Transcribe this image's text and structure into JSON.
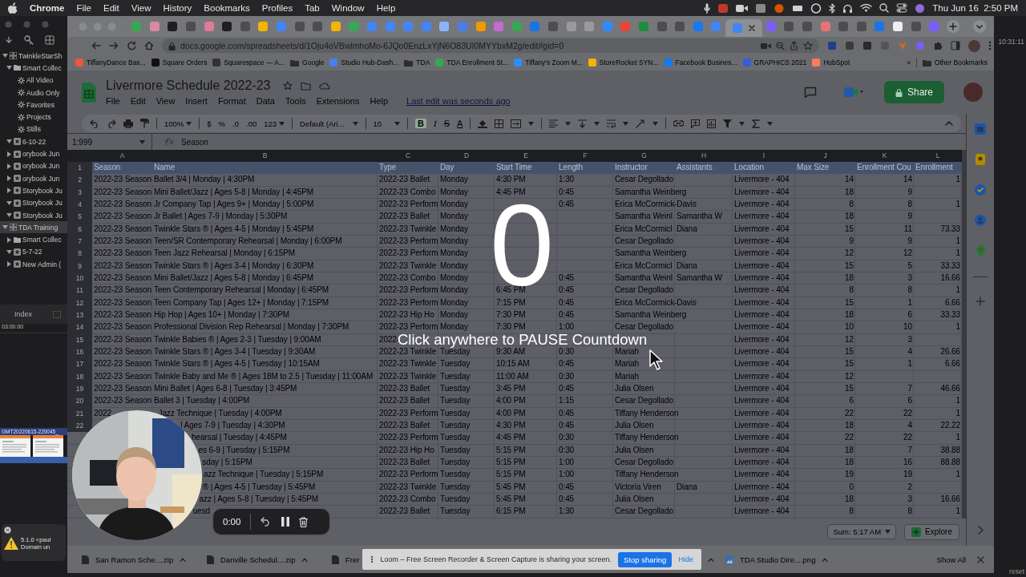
{
  "menubar": {
    "app": "Chrome",
    "menus": [
      "File",
      "Edit",
      "View",
      "History",
      "Bookmarks",
      "Profiles",
      "Tab",
      "Window",
      "Help"
    ],
    "clock": "Thu Jun 16  2:50 PM"
  },
  "library": {
    "items": [
      {
        "label": "TwinkleStarSh",
        "kind": "library",
        "expanded": true,
        "selected": false,
        "children": [
          {
            "label": "Smart Collec",
            "kind": "folder",
            "expanded": true,
            "selected": false,
            "children": [
              {
                "label": "All Video",
                "kind": "smart",
                "selected": false
              },
              {
                "label": "Audio Only",
                "kind": "smart",
                "selected": false
              },
              {
                "label": "Favorites",
                "kind": "smart",
                "selected": false
              },
              {
                "label": "Projects",
                "kind": "smart",
                "selected": false
              },
              {
                "label": "Stills",
                "kind": "smart",
                "selected": false
              }
            ]
          },
          {
            "label": "6-10-22",
            "kind": "event",
            "expanded": true,
            "selected": false
          },
          {
            "label": "orybook Jun",
            "kind": "event",
            "expanded": false,
            "selected": false
          },
          {
            "label": "orybook Jun",
            "kind": "event",
            "expanded": false,
            "selected": false
          },
          {
            "label": "orybook Jun",
            "kind": "event",
            "expanded": false,
            "selected": false
          },
          {
            "label": "Storybook Ju",
            "kind": "event",
            "expanded": false,
            "selected": false
          },
          {
            "label": "Storybook Ju",
            "kind": "event",
            "expanded": true,
            "selected": false
          },
          {
            "label": "Storybook Ju",
            "kind": "event",
            "expanded": true,
            "selected": false
          }
        ]
      },
      {
        "label": "TDA Training",
        "kind": "library",
        "expanded": true,
        "selected": true,
        "children": [
          {
            "label": "Smart Collec",
            "kind": "folder",
            "expanded": false,
            "selected": false
          },
          {
            "label": "5-7-22",
            "kind": "event",
            "expanded": true,
            "selected": false
          },
          {
            "label": "New Admin (",
            "kind": "event",
            "expanded": false,
            "selected": false
          }
        ]
      }
    ],
    "index_button": "Index",
    "timecode": "03:00:00",
    "clip_label": "GMT20220615-220045_",
    "alert_lines": [
      "5.1.0 <paul",
      "Domain un"
    ]
  },
  "browser": {
    "tabs": [
      {
        "selected": false,
        "color": "#34a853"
      },
      {
        "selected": false,
        "color": "#d98aa0"
      },
      {
        "selected": false,
        "color": "#1f1f1f"
      },
      {
        "selected": false,
        "color": "#4d4d4d"
      },
      {
        "selected": false,
        "color": "#e07a95"
      },
      {
        "selected": false,
        "color": "#1f1f1f"
      },
      {
        "selected": false,
        "color": "#4d4d4d"
      },
      {
        "selected": false,
        "color": "#f4b400"
      },
      {
        "selected": false,
        "color": "#4285f4"
      },
      {
        "selected": false,
        "color": "#4d4d4d"
      },
      {
        "selected": false,
        "color": "#4d4d4d"
      },
      {
        "selected": false,
        "color": "#f4b400"
      },
      {
        "selected": false,
        "color": "#34a853"
      },
      {
        "selected": false,
        "color": "#4285f4"
      },
      {
        "selected": false,
        "color": "#4285f4"
      },
      {
        "selected": false,
        "color": "#4285f4"
      },
      {
        "selected": false,
        "color": "#4285f4"
      },
      {
        "selected": false,
        "color": "#8ab4f8"
      },
      {
        "selected": false,
        "color": "#4a7ee8"
      },
      {
        "selected": false,
        "color": "#f29900"
      },
      {
        "selected": false,
        "color": "#c46bd0"
      },
      {
        "selected": false,
        "color": "#34a853"
      },
      {
        "selected": false,
        "color": "#1a73e8"
      },
      {
        "selected": false,
        "color": "#4d4d4d"
      },
      {
        "selected": false,
        "color": "#9a9a9a"
      },
      {
        "selected": false,
        "color": "#9a9a9a"
      },
      {
        "selected": false,
        "color": "#2d8cff"
      },
      {
        "selected": false,
        "color": "#ea4335"
      },
      {
        "selected": false,
        "color": "#1e8e3e"
      },
      {
        "selected": false,
        "color": "#4d4d4d"
      },
      {
        "selected": false,
        "color": "#4d4d4d"
      },
      {
        "selected": false,
        "color": "#1877f2"
      },
      {
        "selected": false,
        "color": "#4285f4"
      },
      {
        "selected": true,
        "color": "#4285f4"
      },
      {
        "selected": false,
        "color": "#7c5cff"
      },
      {
        "selected": false,
        "color": "#4d4d4d"
      },
      {
        "selected": false,
        "color": "#4d4d4d"
      },
      {
        "selected": false,
        "color": "#e57373"
      },
      {
        "selected": false,
        "color": "#4d4d4d"
      },
      {
        "selected": false,
        "color": "#4d4d4d"
      },
      {
        "selected": false,
        "color": "#1a73e8"
      },
      {
        "selected": false,
        "color": "#eeeeee"
      },
      {
        "selected": false,
        "color": "#4d4d4d"
      },
      {
        "selected": false,
        "color": "#7c5cff"
      }
    ],
    "url": "docs.google.com/spreadsheets/d/1Oju4oVBwlmhoMo-6JQo0EnzLxYjN6O83UI0MYYbxM2g/edit#gid=0",
    "bookmarks": [
      {
        "label": "TiffanyDance Bas...",
        "kind": "site",
        "color": "#e8593c"
      },
      {
        "label": "Square Orders",
        "kind": "site",
        "color": "#111111"
      },
      {
        "label": "Squarespace — A...",
        "kind": "site",
        "color": "#333333"
      },
      {
        "label": "Google",
        "kind": "folder"
      },
      {
        "label": "Studio Hub-Dash...",
        "kind": "site",
        "color": "#4a7ee8"
      },
      {
        "label": "TDA",
        "kind": "folder"
      },
      {
        "label": "TDA Enrollment St...",
        "kind": "site",
        "color": "#34a853"
      },
      {
        "label": "Tiffany's Zoom M...",
        "kind": "site",
        "color": "#2d8cff"
      },
      {
        "label": "StoreRocket SYN...",
        "kind": "site",
        "color": "#f4b400"
      },
      {
        "label": "Facebook Busines...",
        "kind": "site",
        "color": "#1877f2"
      },
      {
        "label": "GRAPHICS 2021",
        "kind": "site",
        "color": "#3b5bdb"
      },
      {
        "label": "HubSpot",
        "kind": "site",
        "color": "#ff7a59"
      }
    ],
    "more_bookmarks": "»",
    "other_bookmarks": "Other Bookmarks"
  },
  "sheet": {
    "title": "Livermore Schedule 2022-23",
    "menus": [
      "File",
      "Edit",
      "View",
      "Insert",
      "Format",
      "Data",
      "Tools",
      "Extensions",
      "Help"
    ],
    "last_edit": "Last edit was seconds ago",
    "share": "Share",
    "toolbar": {
      "zoom": "100%",
      "currency": "$",
      "percent": "%",
      "decimal_less": ".0",
      "decimal_more": ".00",
      "number_format": "123",
      "font": "Default (Ari...",
      "font_size": "10",
      "bold": "B",
      "italic": "I",
      "strikethrough": "S",
      "text_color": "A"
    },
    "name_box": "1:999",
    "formula": "Season",
    "columns": [
      {
        "letter": "A",
        "kind": "text"
      },
      {
        "letter": "B",
        "kind": "text"
      },
      {
        "letter": "C",
        "kind": "text"
      },
      {
        "letter": "D",
        "kind": "text"
      },
      {
        "letter": "E",
        "kind": "text"
      },
      {
        "letter": "F",
        "kind": "text"
      },
      {
        "letter": "G",
        "kind": "text"
      },
      {
        "letter": "H",
        "kind": "text"
      },
      {
        "letter": "I",
        "kind": "text"
      },
      {
        "letter": "J",
        "kind": "number"
      },
      {
        "letter": "K",
        "kind": "number"
      },
      {
        "letter": "L",
        "kind": "number"
      }
    ],
    "rows": [
      {
        "number": "1",
        "kind": "header",
        "cells": [
          "Season",
          "Name",
          "Type",
          "Day",
          "Start Time",
          "Length",
          "Instructor",
          "Assistants",
          "Location",
          "Max Size",
          "Enrollment Cou",
          "Enrollment"
        ]
      },
      {
        "number": "2",
        "kind": "data",
        "cells": [
          "2022-23 Season",
          "Ballet 3/4 | Monday | 4:30PM",
          "2022-23 Ballet",
          "Monday",
          "4:30 PM",
          "1:30",
          "Cesar Degollado",
          null,
          "Livermore - 404",
          "14",
          "14",
          "1"
        ]
      },
      {
        "number": "3",
        "kind": "data",
        "cells": [
          "2022-23 Season",
          "Mini Ballet/Jazz | Ages 5-8 | Monday | 4:45PM",
          "2022-23 Combo",
          "Monday",
          "4:45 PM",
          "0:45",
          "Samantha Weinberg",
          null,
          "Livermore - 404",
          "18",
          "9",
          null
        ]
      },
      {
        "number": "4",
        "kind": "data",
        "cells": [
          "2022-23 Season",
          "Jr Company Tap | Ages 9+ | Monday | 5:00PM",
          "2022-23 Perform",
          "Monday",
          null,
          "0:45",
          "Erica McCormick-Davis",
          null,
          "Livermore - 404",
          "8",
          "8",
          "1"
        ]
      },
      {
        "number": "5",
        "kind": "data",
        "cells": [
          "2022-23 Season",
          "Jr Ballet | Ages 7-9 | Monday | 5:30PM",
          "2022-23 Ballet",
          "Monday",
          null,
          null,
          "Samantha Weinl",
          "Samantha W",
          "Livermore - 404",
          "18",
          "9",
          null
        ]
      },
      {
        "number": "6",
        "kind": "data",
        "cells": [
          "2022-23 Season",
          "Twinkle Stars ® | Ages 4-5 | Monday | 5:45PM",
          "2022-23 Twinkle",
          "Monday",
          null,
          null,
          "Erica McCormicl",
          "Diana",
          "Livermore - 404",
          "15",
          "11",
          "73.33"
        ]
      },
      {
        "number": "7",
        "kind": "data",
        "cells": [
          "2022-23 Season",
          "Teen/SR Contemporary Rehearsal | Monday | 6:00PM",
          "2022-23 Perform",
          "Monday",
          null,
          null,
          "Cesar Degollado",
          null,
          "Livermore - 404",
          "9",
          "9",
          "1"
        ]
      },
      {
        "number": "8",
        "kind": "data",
        "cells": [
          "2022-23 Season",
          "Teen Jazz Rehearsal | Monday | 6:15PM",
          "2022-23 Perform",
          "Monday",
          null,
          null,
          "Samantha Weinberg",
          null,
          "Livermore - 404",
          "12",
          "12",
          "1"
        ]
      },
      {
        "number": "9",
        "kind": "data",
        "cells": [
          "2022-23 Season",
          "Twinkle Stars ® | Ages 3-4 | Monday | 6:30PM",
          "2022-23 Twinkle",
          "Monday",
          null,
          null,
          "Erica McCormicl",
          "Diana",
          "Livermore - 404",
          "15",
          "5",
          "33.33"
        ]
      },
      {
        "number": "10",
        "kind": "data",
        "cells": [
          "2022-23 Season",
          "Mini Ballet/Jazz | Ages 5-8 | Monday | 6:45PM",
          "2022-23 Combo",
          "Monday",
          null,
          "0:45",
          "Samantha Weinl",
          "Samantha W",
          "Livermore - 404",
          "18",
          "3",
          "16.66"
        ]
      },
      {
        "number": "11",
        "kind": "data",
        "cells": [
          "2022-23 Season",
          "Teen Contemporary Rehearsal | Monday | 6:45PM",
          "2022-23 Perform",
          "Monday",
          "6:45 PM",
          "0:45",
          "Cesar Degollado",
          null,
          "Livermore - 404",
          "8",
          "8",
          "1"
        ]
      },
      {
        "number": "12",
        "kind": "data",
        "cells": [
          "2022-23 Season",
          "Teen Company Tap | Ages 12+ | Monday | 7:15PM",
          "2022-23 Perform",
          "Monday",
          "7:15 PM",
          "0:45",
          "Erica McCormick-Davis",
          null,
          "Livermore - 404",
          "15",
          "1",
          "6.66"
        ]
      },
      {
        "number": "13",
        "kind": "data",
        "cells": [
          "2022-23 Season",
          "Hip Hop | Ages 10+ | Monday | 7:30PM",
          "2022-23 Hip Ho",
          "Monday",
          "7:30 PM",
          "0:45",
          "Samantha Weinberg",
          null,
          "Livermore - 404",
          "18",
          "6",
          "33.33"
        ]
      },
      {
        "number": "14",
        "kind": "data",
        "cells": [
          "2022-23 Season",
          "Professional Division Rep Rehearsal | Monday | 7:30PM",
          "2022-23 Perform",
          "Monday",
          "7:30 PM",
          "1:00",
          "Cesar Degollado",
          null,
          "Livermore - 404",
          "10",
          "10",
          "1"
        ]
      },
      {
        "number": "15",
        "kind": "data",
        "cells": [
          "2022-23 Season",
          "Twinkle Babies ® | Ages 2-3 | Tuesday | 9:00AM",
          "2022-",
          null,
          null,
          null,
          null,
          null,
          "Livermore - 404",
          "12",
          "3",
          null
        ]
      },
      {
        "number": "16",
        "kind": "data",
        "cells": [
          "2022-23 Season",
          "Twinkle Stars ® | Ages 3-4 | Tuesday | 9:30AM",
          "2022-23 Twinkle",
          "Tuesday",
          "9:30 AM",
          "0:30",
          "Mariah",
          null,
          "Livermore - 404",
          "15",
          "4",
          "26.66"
        ]
      },
      {
        "number": "17",
        "kind": "data",
        "cells": [
          "2022-23 Season",
          "Twinkle Stars ® | Ages 4-5 | Tuesday | 10:15AM",
          "2022-23 Twinkle",
          "Tuesday",
          "10:15 AM",
          "0:45",
          "Mariah",
          null,
          "Livermore - 404",
          "15",
          "1",
          "6.66"
        ]
      },
      {
        "number": "18",
        "kind": "data",
        "cells": [
          "2022-23 Season",
          "Twinkle Baby and Me ® | Ages 18M to 2.5 | Tuesday | 11:00AM",
          "2022-23 Twinkle",
          "Tuesday",
          "11:00 AM",
          "0:30",
          "Mariah",
          null,
          "Livermore - 404",
          "12",
          null,
          null
        ]
      },
      {
        "number": "19",
        "kind": "data",
        "cells": [
          "2022-23 Season",
          "Mini Ballet | Ages 6-8 | Tuesday | 3:45PM",
          "2022-23 Ballet",
          "Tuesday",
          "3:45 PM",
          "0:45",
          "Julia Olsen",
          null,
          "Livermore - 404",
          "15",
          "7",
          "46.66"
        ]
      },
      {
        "number": "20",
        "kind": "data",
        "cells": [
          "2022-23 Season",
          "Ballet 3 | Tuesday | 4:00PM",
          "2022-23 Ballet",
          "Tuesday",
          "4:00 PM",
          "1:15",
          "Cesar Degollado",
          null,
          "Livermore - 404",
          "6",
          "6",
          "1"
        ]
      },
      {
        "number": "21",
        "kind": "data",
        "cells": [
          "2022",
          "Jazz Technique | Tuesday | 4:00PM",
          "2022-23 Perform",
          "Tuesday",
          "4:00 PM",
          "0:45",
          "Tiffany Henderson",
          null,
          "Livermore - 404",
          "22",
          "22",
          "1"
        ]
      },
      {
        "number": "22",
        "kind": "data",
        "cells": [
          null,
          "| Ages 7-9 | Tuesday | 4:30PM",
          "2022-23 Ballet",
          "Tuesday",
          "4:30 PM",
          "0:45",
          "Julia Olsen",
          null,
          "Livermore - 404",
          "18",
          "4",
          "22.22"
        ]
      },
      {
        "kind": "data",
        "cells": [
          null,
          "hearsal | Tuesday | 4:45PM",
          "2022-23 Perform",
          "Tuesday",
          "4:45 PM",
          "0:30",
          "Tiffany Henderson",
          null,
          "Livermore - 404",
          "22",
          "22",
          "1"
        ]
      },
      {
        "kind": "data",
        "cells": [
          null,
          "es 6-9 | Tuesday | 5:15PM",
          "2022-23 Hip Ho",
          "Tuesday",
          "5:15 PM",
          "0:30",
          "Julia Olsen",
          null,
          "Livermore - 404",
          "18",
          "7",
          "38.88"
        ]
      },
      {
        "kind": "data",
        "cells": [
          null,
          "sday | 5:15PM",
          "2022-23 Ballet",
          "Tuesday",
          "5:15 PM",
          "1:00",
          "Cesar Degollado",
          null,
          "Livermore - 404",
          "18",
          "16",
          "88.88"
        ]
      },
      {
        "kind": "data",
        "cells": [
          null,
          "azz Technique | Tuesday | 5:15PM",
          "2022-23 Perform",
          "Tuesday",
          "5:15 PM",
          "1:00",
          "Tiffany Henderson",
          null,
          "Livermore - 404",
          "19",
          "19",
          "1"
        ]
      },
      {
        "kind": "data",
        "cells": [
          null,
          "® | Ages 4-5 | Tuesday | 5:45PM",
          "2022-23 Twinkle",
          "Tuesday",
          "5:45 PM",
          "0:45",
          "Victoria Viren",
          "Diana",
          "Livermore - 404",
          "0",
          "2",
          null
        ]
      },
      {
        "kind": "data",
        "cells": [
          null,
          "azz | Ages 5-8 | Tuesday | 5:45PM",
          "2022-23 Combo",
          "Tuesday",
          "5:45 PM",
          "0:45",
          "Julia Olsen",
          null,
          "Livermore - 404",
          "18",
          "3",
          "16.66"
        ]
      },
      {
        "kind": "data",
        "cells": [
          null,
          "uesd",
          "2022-23 Ballet",
          "Tuesday",
          "6:15 PM",
          "1:30",
          "Cesar Degollado",
          null,
          "Livermore - 404",
          "8",
          "8",
          "1"
        ]
      }
    ],
    "sum": "Sum: 5:17 AM",
    "explore": "Explore"
  },
  "downloads": {
    "items": [
      {
        "name": "San Ramon Sche....zip"
      },
      {
        "name": "Danville Schedul....zip"
      },
      {
        "name": "Frer"
      }
    ],
    "after": [
      {
        "name": "TDA Studio Dire....png"
      }
    ],
    "show_all": "Show All"
  },
  "loom_notice": {
    "text": "Loom – Free Screen Recorder & Screen Capture is sharing your screen.",
    "stop": "Stop sharing",
    "hide": "Hide"
  },
  "countdown": {
    "number": "0",
    "hint": "Click anywhere to PAUSE Countdown"
  },
  "recorder": {
    "time": "0:00"
  },
  "right_edge": {
    "timecode": "10:31:11",
    "reset": "reset"
  }
}
